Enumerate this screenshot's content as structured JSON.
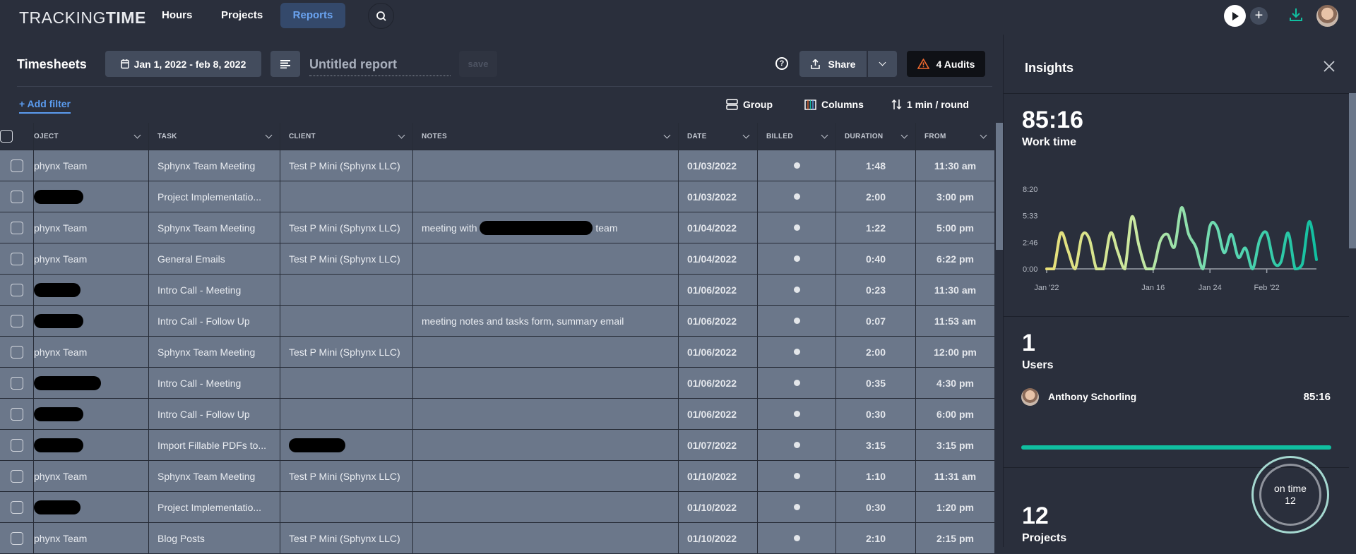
{
  "nav": {
    "logo_light": "TRACKING",
    "logo_bold": "TIME",
    "items": [
      {
        "label": "Hours"
      },
      {
        "label": "Projects"
      },
      {
        "label": "Reports",
        "active": true
      }
    ]
  },
  "toolbar": {
    "title": "Timesheets",
    "date_range": "Jan 1, 2022 - feb 8, 2022",
    "report_name_placeholder": "Untitled report",
    "save": "save",
    "share": "Share",
    "audits": "4 Audits",
    "add_filter": "+ Add filter",
    "group": "Group",
    "columns": "Columns",
    "rounding": "1 min / round"
  },
  "table": {
    "headers": [
      "OJECT",
      "TASK",
      "CLIENT",
      "NOTES",
      "DATE",
      "BILLED",
      "DURATION",
      "FROM"
    ],
    "rows": [
      {
        "project": "phynx Team",
        "task": "Sphynx Team Meeting",
        "client": "Test P Mini (Sphynx LLC)",
        "notes": "",
        "date": "01/03/2022",
        "duration": "1:48",
        "from": "11:30 am"
      },
      {
        "project": null,
        "task": "Project Implementatio...",
        "client": "",
        "notes": "",
        "date": "01/03/2022",
        "duration": "2:00",
        "from": "3:00 pm"
      },
      {
        "project": "phynx Team",
        "task": "Sphynx Team Meeting",
        "client": "Test P Mini (Sphynx LLC)",
        "notes": "meeting with",
        "notes_after": "team",
        "date": "01/04/2022",
        "duration": "1:22",
        "from": "5:00 pm"
      },
      {
        "project": "phynx Team",
        "task": "General Emails",
        "client": "Test P Mini (Sphynx LLC)",
        "notes": "",
        "date": "01/04/2022",
        "duration": "0:40",
        "from": "6:22 pm"
      },
      {
        "project": null,
        "task": "Intro Call - Meeting",
        "client": "",
        "notes": "",
        "date": "01/06/2022",
        "duration": "0:23",
        "from": "11:30 am"
      },
      {
        "project": null,
        "task": "Intro Call - Follow Up",
        "client": "",
        "notes": "meeting notes and tasks form, summary email",
        "date": "01/06/2022",
        "duration": "0:07",
        "from": "11:53 am"
      },
      {
        "project": "phynx Team",
        "task": "Sphynx Team Meeting",
        "client": "Test P Mini (Sphynx LLC)",
        "notes": "",
        "date": "01/06/2022",
        "duration": "2:00",
        "from": "12:00 pm"
      },
      {
        "project": null,
        "task": "Intro Call - Meeting",
        "client": "",
        "notes": "",
        "date": "01/06/2022",
        "duration": "0:35",
        "from": "4:30 pm"
      },
      {
        "project": null,
        "task": "Intro Call - Follow Up",
        "client": "",
        "notes": "",
        "date": "01/06/2022",
        "duration": "0:30",
        "from": "6:00 pm"
      },
      {
        "project": null,
        "task": "Import Fillable PDFs to...",
        "client": null,
        "notes": "",
        "date": "01/07/2022",
        "duration": "3:15",
        "from": "3:15 pm"
      },
      {
        "project": "phynx Team",
        "task": "Sphynx Team Meeting",
        "client": "Test P Mini (Sphynx LLC)",
        "notes": "",
        "date": "01/10/2022",
        "duration": "1:10",
        "from": "11:31 am"
      },
      {
        "project": null,
        "task": "Project Implementatio...",
        "client": "",
        "notes": "",
        "date": "01/10/2022",
        "duration": "0:30",
        "from": "1:20 pm"
      },
      {
        "project": "phynx Team",
        "task": "Blog Posts",
        "client": "Test P Mini (Sphynx LLC)",
        "notes": "",
        "date": "01/10/2022",
        "duration": "2:10",
        "from": "2:15 pm"
      }
    ]
  },
  "insights": {
    "title": "Insights",
    "work_time_value": "85:16",
    "work_time_label": "Work time",
    "users_count": "1",
    "users_label": "Users",
    "user_name": "Anthony Schorling",
    "user_time": "85:16",
    "user_share": 1.0,
    "projects_count": "12",
    "projects_label": "Projects",
    "ring_label": "on time",
    "ring_value": "12"
  },
  "chart_data": {
    "type": "line",
    "title": "Work time",
    "y_ticks": [
      "0:00",
      "2:46",
      "5:33",
      "8:20"
    ],
    "ylim_minutes": [
      0,
      500
    ],
    "x_ticks": [
      {
        "label": "Jan '22",
        "day": 0
      },
      {
        "label": "Jan 16",
        "day": 15
      },
      {
        "label": "Jan 24",
        "day": 23
      },
      {
        "label": "Feb '22",
        "day": 31
      }
    ],
    "x_start": "2022-01-01",
    "x_end": "2022-02-08",
    "values_minutes": [
      0,
      0,
      225,
      116,
      0,
      210,
      188,
      0,
      0,
      225,
      109,
      0,
      326,
      145,
      0,
      0,
      174,
      217,
      138,
      384,
      217,
      138,
      0,
      268,
      261,
      101,
      217,
      72,
      130,
      0,
      181,
      225,
      43,
      43,
      225,
      0,
      29,
      297,
      58
    ],
    "colors": [
      "#e8df78",
      "#c9e8a2",
      "#5fd8b3",
      "#10bfa0"
    ]
  },
  "colors": {
    "accent": "#10bfa0",
    "link": "#5b9cf0",
    "warning": "#f26a2e"
  }
}
